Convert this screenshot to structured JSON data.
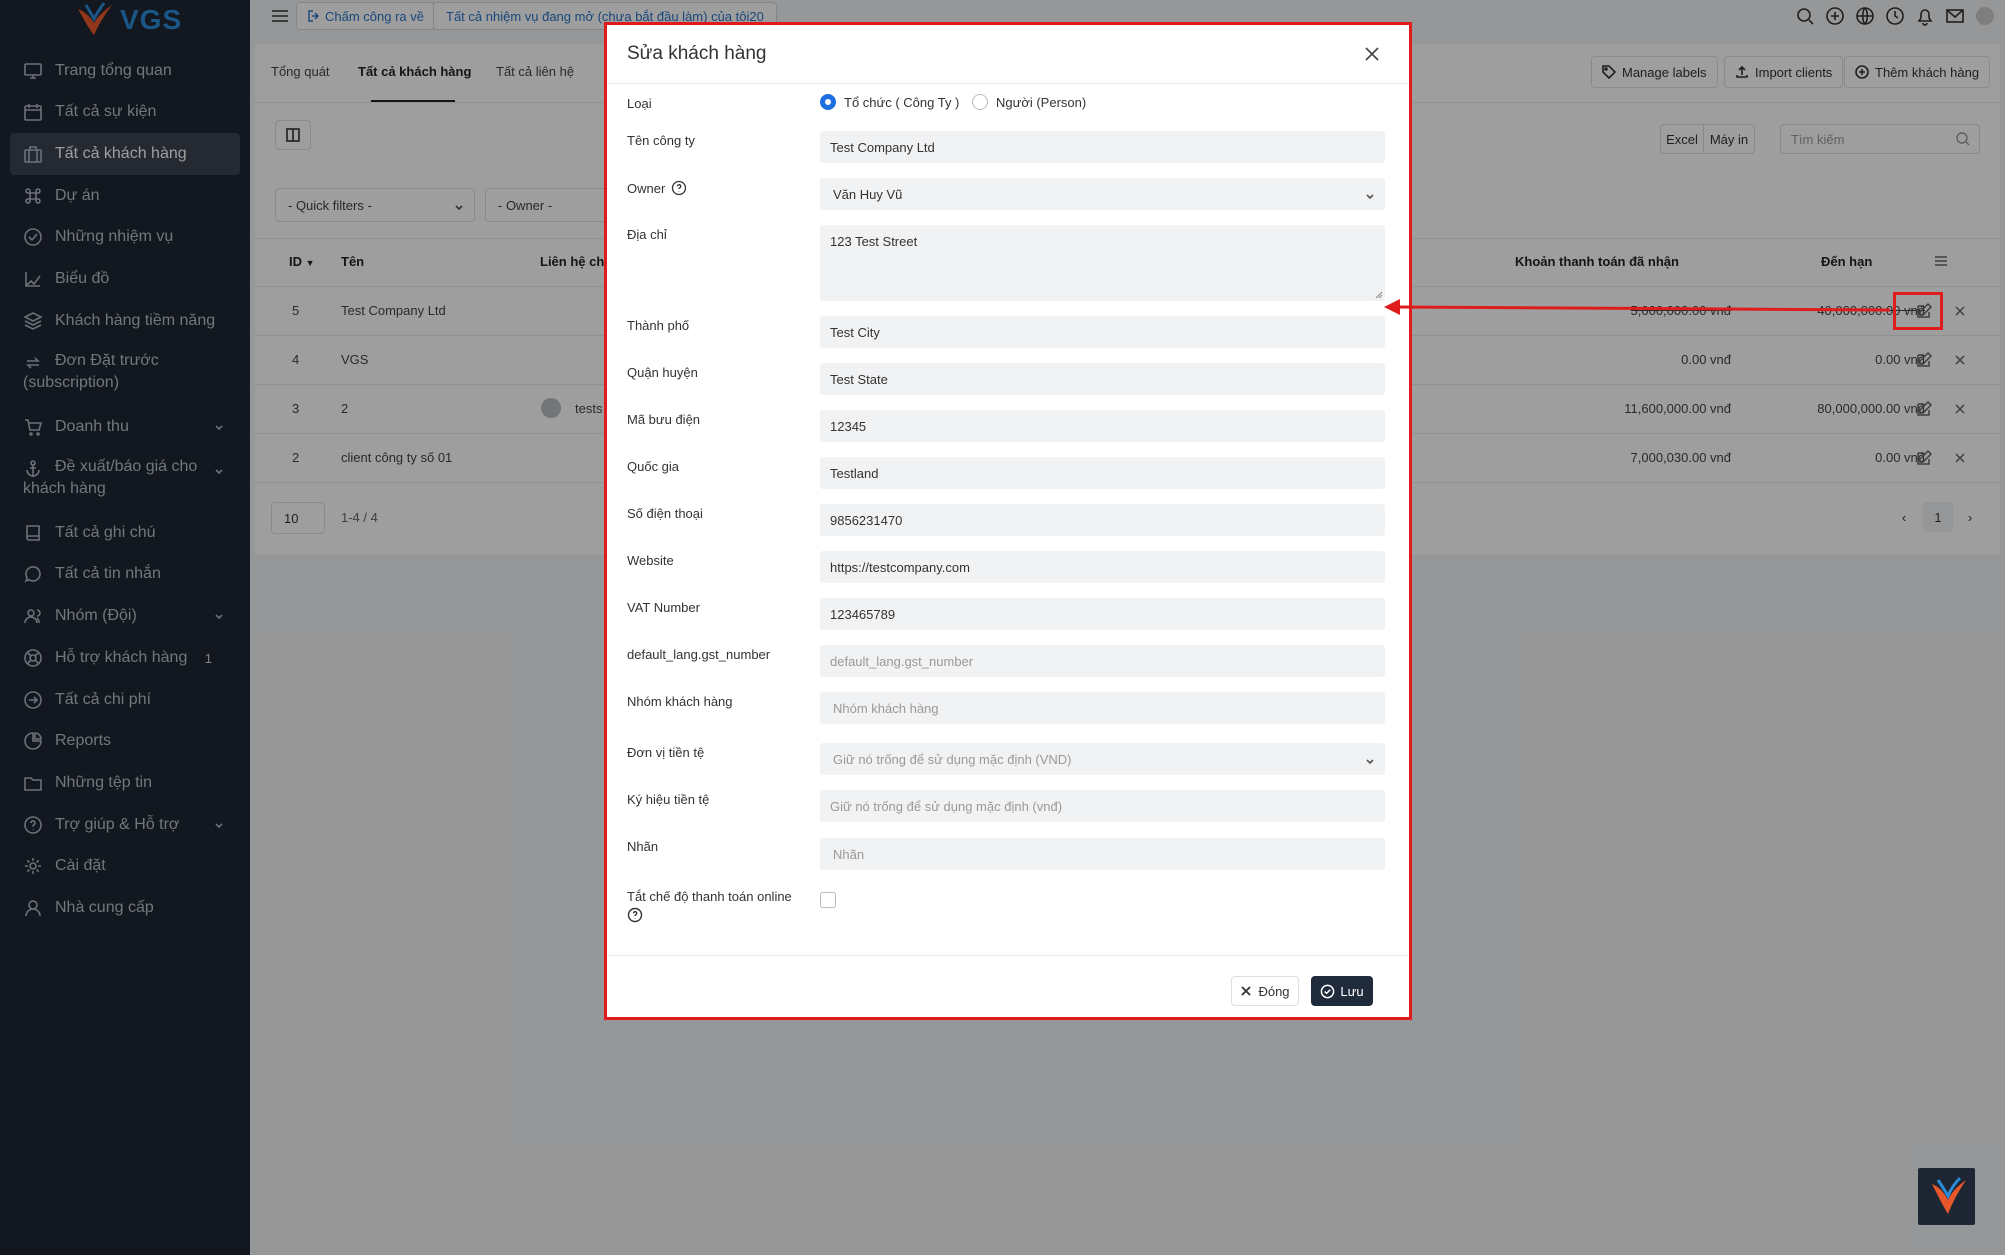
{
  "app": {
    "logo_text": "VGS"
  },
  "sidebar": {
    "items": [
      {
        "label": "Trang tổng quan",
        "icon": "monitor-icon"
      },
      {
        "label": "Tất cả sự kiện",
        "icon": "calendar-icon"
      },
      {
        "label": "Tất cả khách hàng",
        "icon": "briefcase-icon",
        "active": true
      },
      {
        "label": "Dự án",
        "icon": "command-icon"
      },
      {
        "label": "Những nhiệm vụ",
        "icon": "check-circle-icon"
      },
      {
        "label": "Biểu đồ",
        "icon": "chart-icon"
      },
      {
        "label": "Khách hàng tiềm năng",
        "icon": "layers-icon"
      },
      {
        "label_line1": "Đơn Đặt trước",
        "label_line2": "(subscription)",
        "icon": "repeat-icon"
      },
      {
        "label": "Doanh thu",
        "icon": "cart-icon"
      },
      {
        "label_line1": "Đề xuất/báo giá cho",
        "label_line2": "khách hàng",
        "icon": "anchor-icon"
      },
      {
        "label": "Tất cả ghi chú",
        "icon": "book-icon"
      },
      {
        "label": "Tất cả tin nhắn",
        "icon": "message-icon"
      },
      {
        "label": "Nhóm (Đội)",
        "icon": "users-icon"
      },
      {
        "label": "Hỗ trợ khách hàng",
        "icon": "lifebuoy-icon",
        "badge": "1"
      },
      {
        "label": "Tất cả chi phí",
        "icon": "arrow-circle-icon"
      },
      {
        "label": "Reports",
        "icon": "pie-icon"
      },
      {
        "label": "Những tệp tin",
        "icon": "folder-icon"
      },
      {
        "label": "Trợ giúp & Hỗ trợ",
        "icon": "help-icon"
      },
      {
        "label": "Cài đặt",
        "icon": "settings-icon"
      },
      {
        "label": "Nhà cung cấp",
        "icon": "user-icon"
      }
    ]
  },
  "topbar": {
    "clock_label": "Chấm công ra về",
    "task_link": "Tất cả nhiệm vụ đang mở (chưa bắt đầu làm) của tôi20"
  },
  "page": {
    "tabs": [
      "Tổng quát",
      "Tất cả khách hàng",
      "Tất cả liên hệ"
    ],
    "buttons": {
      "labels": "Manage labels",
      "import": "Import clients",
      "add": "Thêm khách hàng"
    },
    "excel": "Excel",
    "print": "Máy in",
    "search_placeholder": "Tìm kiếm",
    "filters": [
      "- Quick filters -",
      "- Owner -"
    ],
    "columns": {
      "id": "ID",
      "name": "Tên",
      "contact": "Liên hệ ch",
      "paid": "Khoản thanh toán đã nhận",
      "due": "Đến hạn"
    },
    "rows": [
      {
        "id": "5",
        "name": "Test Company Ltd",
        "contact": "",
        "paid": "5,000,000.00 vnđ",
        "due": "40,000,000.00 vnđ"
      },
      {
        "id": "4",
        "name": "VGS",
        "contact": "",
        "paid": "0.00 vnđ",
        "due": "0.00 vnđ"
      },
      {
        "id": "3",
        "name": "2",
        "contact": "tests",
        "paid": "11,600,000.00 vnđ",
        "due": "80,000,000.00 vnđ"
      },
      {
        "id": "2",
        "name": "client công ty số 01",
        "contact": "",
        "paid": "7,000,030.00 vnđ",
        "due": "0.00 vnđ"
      }
    ],
    "page_size": "10",
    "page_info": "1-4 / 4",
    "current_page": "1"
  },
  "modal": {
    "title": "Sửa khách hàng",
    "type_label": "Loại",
    "type_options": [
      "Tổ chức ( Công Ty )",
      "Người (Person)"
    ],
    "fields": {
      "company_name": {
        "label": "Tên công ty",
        "value": "Test Company Ltd"
      },
      "owner": {
        "label": "Owner",
        "value": "Văn Huy Vũ"
      },
      "address": {
        "label": "Địa chỉ",
        "value": "123 Test Street"
      },
      "city": {
        "label": "Thành phố",
        "value": "Test City"
      },
      "district": {
        "label": "Quận huyện",
        "value": "Test State"
      },
      "zip": {
        "label": "Mã bưu điện",
        "value": "12345"
      },
      "country": {
        "label": "Quốc gia",
        "value": "Testland"
      },
      "phone": {
        "label": "Số điện thoại",
        "value": "9856231470"
      },
      "website": {
        "label": "Website",
        "value": "https://testcompany.com"
      },
      "vat": {
        "label": "VAT Number",
        "value": "123465789"
      },
      "gst": {
        "label": "default_lang.gst_number",
        "placeholder": "default_lang.gst_number"
      },
      "group": {
        "label": "Nhóm khách hàng",
        "placeholder": "Nhóm khách hàng"
      },
      "currency": {
        "label": "Đơn vị tiền tệ",
        "placeholder": "Giữ nó trống để sử dụng mặc định (VND)"
      },
      "currency_symbol": {
        "label": "Ký hiệu tiền tệ",
        "placeholder": "Giữ nó trống để sử dụng mặc định (vnđ)"
      },
      "labels": {
        "label": "Nhãn",
        "placeholder": "Nhãn"
      },
      "online_payment": {
        "label": "Tắt chế độ thanh toán online"
      }
    },
    "close_label": "Đóng",
    "save_label": "Lưu"
  },
  "colors": {
    "sidebar_bg": "#1f2633",
    "accent": "#1e6fe0",
    "annotation": "#e01b1b"
  }
}
